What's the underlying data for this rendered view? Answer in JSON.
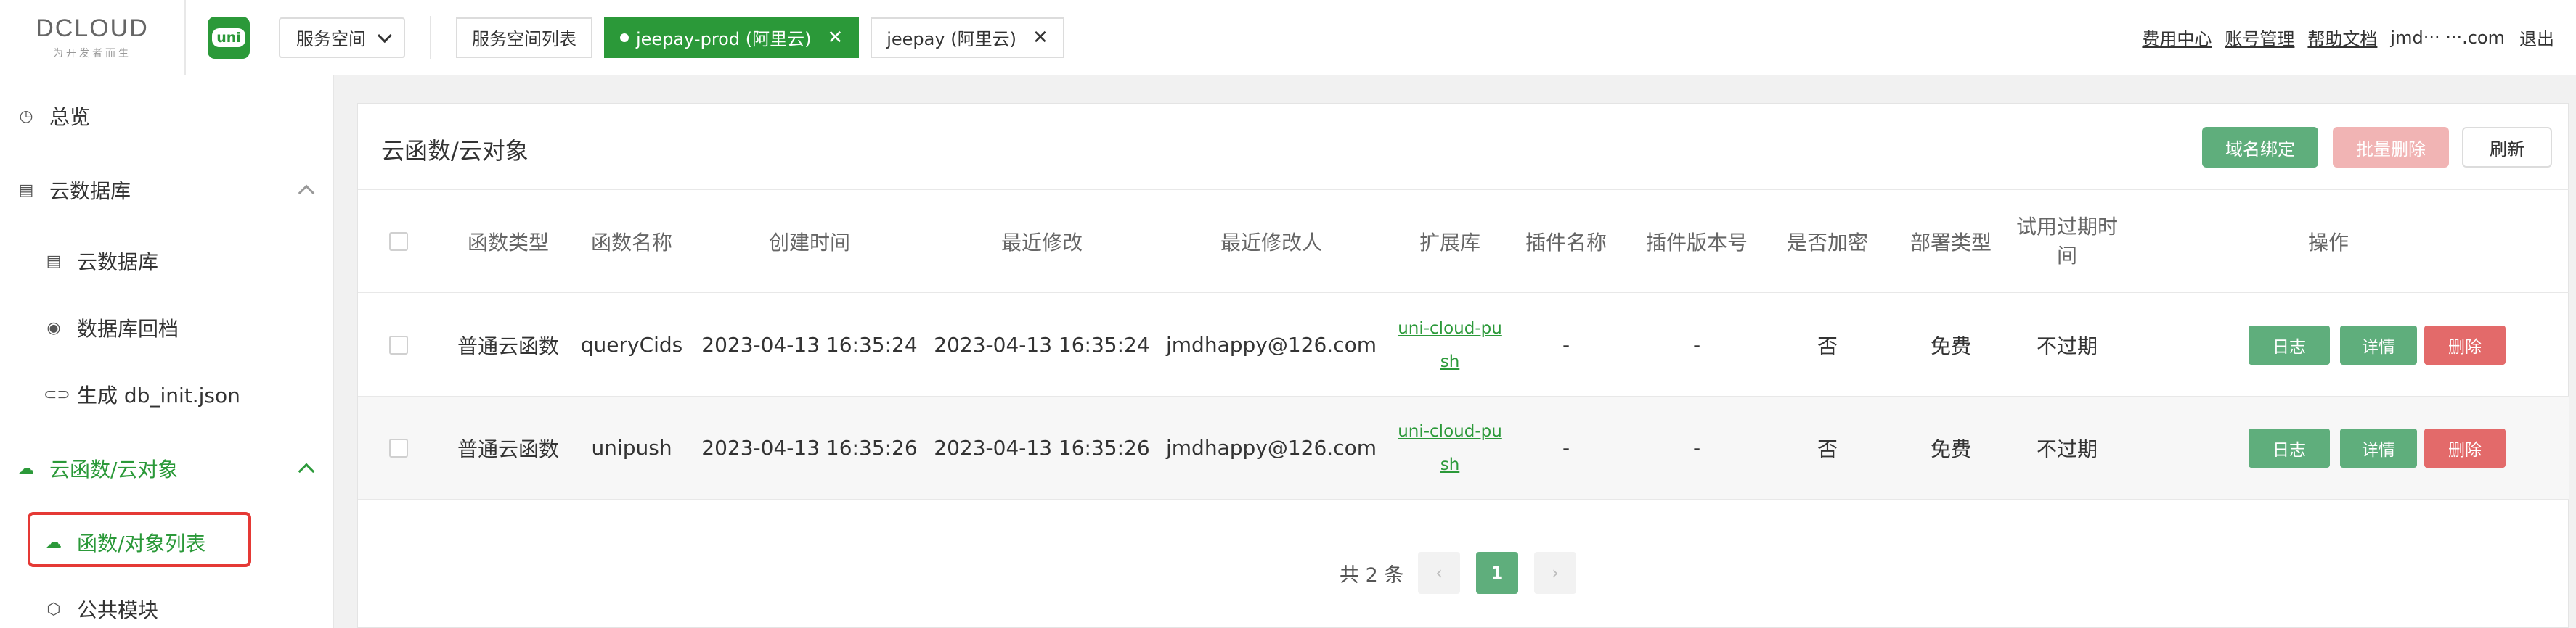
{
  "header": {
    "logo_text": "DCLOUD",
    "logo_sub": "为开发者而生",
    "uni_badge": "uni",
    "space_select": "服务空间",
    "tabs": [
      {
        "label": "服务空间列表",
        "active": false
      },
      {
        "label": "jeepay-prod (阿里云)",
        "active": true
      },
      {
        "label": "jeepay (阿里云)",
        "active": false
      }
    ],
    "links": [
      "费用中心",
      "账号管理",
      "帮助文档"
    ],
    "email": "jmd··· ···.com",
    "logout": "退出"
  },
  "sidebar": {
    "items": [
      {
        "label": "总览",
        "icon": "dashboard-icon"
      },
      {
        "label": "云数据库",
        "icon": "database-icon"
      },
      {
        "label": "云数据库",
        "icon": "table-icon"
      },
      {
        "label": "数据库回档",
        "icon": "restore-icon"
      },
      {
        "label": "生成 db_init.json",
        "icon": "link-icon"
      },
      {
        "label": "云函数/云对象",
        "icon": "cloud-icon"
      },
      {
        "label": "函数/对象列表",
        "icon": "cloud-icon"
      },
      {
        "label": "公共模块",
        "icon": "module-icon"
      }
    ]
  },
  "main": {
    "title": "云函数/云对象",
    "buttons": {
      "domain": "域名绑定",
      "batch_delete": "批量删除",
      "refresh": "刷新"
    },
    "columns": [
      "函数类型",
      "函数名称",
      "创建时间",
      "最近修改",
      "最近修改人",
      "扩展库",
      "插件名称",
      "插件版本号",
      "是否加密",
      "部署类型",
      "试用过期时间",
      "操作"
    ],
    "rows": [
      {
        "type": "普通云函数",
        "name": "queryCids",
        "created": "2023-04-13 16:35:24",
        "modified": "2023-04-13 16:35:24",
        "modifier": "jmdhappy@126.com",
        "ext_line1": "uni-cloud-pu",
        "ext_line2": "sh",
        "plugin_name": "-",
        "plugin_version": "-",
        "encrypted": "否",
        "deploy": "免费",
        "expire": "不过期"
      },
      {
        "type": "普通云函数",
        "name": "unipush",
        "created": "2023-04-13 16:35:26",
        "modified": "2023-04-13 16:35:26",
        "modifier": "jmdhappy@126.com",
        "ext_line1": "uni-cloud-pu",
        "ext_line2": "sh",
        "plugin_name": "-",
        "plugin_version": "-",
        "encrypted": "否",
        "deploy": "免费",
        "expire": "不过期"
      }
    ],
    "row_actions": {
      "log": "日志",
      "detail": "详情",
      "delete": "删除"
    },
    "pagination": {
      "total": "共 2 条",
      "prev": "‹",
      "current": "1",
      "next": "›"
    }
  },
  "colors": {
    "brand_green": "#2b9939",
    "button_green": "#5fae7c",
    "danger": "#e36a6a",
    "highlight": "#e53935"
  }
}
